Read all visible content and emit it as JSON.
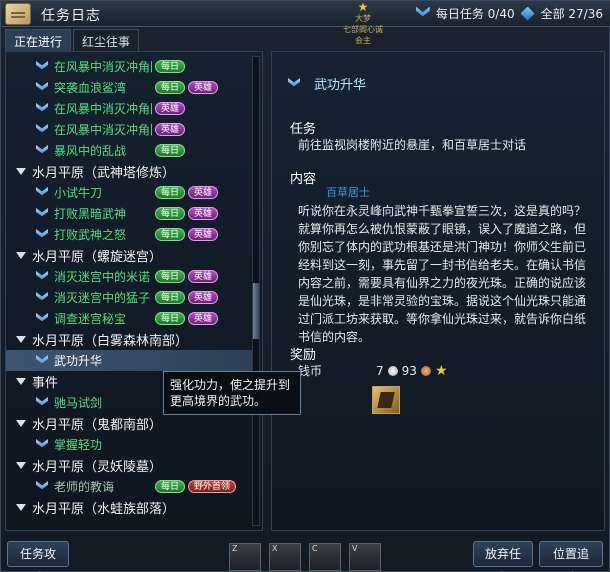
{
  "window": {
    "title": "任务日志",
    "npc_badge": "大梦",
    "npc_badge_sub": "七部阁心诚会主",
    "daily_tasks": "每日任务 0/40",
    "all_tasks": "全部 27/36"
  },
  "tabs": [
    {
      "label": "正在进行",
      "active": true
    },
    {
      "label": "红尘往事",
      "active": false
    }
  ],
  "quest_list": [
    {
      "type": "quest",
      "name": "在风暴中消灭冲角团合作者",
      "tags": [
        "daily"
      ],
      "color": "green"
    },
    {
      "type": "quest",
      "name": "突袭血浪鲨湾",
      "tags": [
        "daily",
        "elite"
      ],
      "color": "green"
    },
    {
      "type": "quest",
      "name": "在风暴中消灭冲角团内务...",
      "tags": [
        "elite"
      ],
      "color": "green"
    },
    {
      "type": "quest",
      "name": "在风暴中消灭冲角团队长",
      "tags": [
        "elite"
      ],
      "color": "green"
    },
    {
      "type": "quest",
      "name": "暴风中的乱战",
      "tags": [
        "daily"
      ],
      "color": "green"
    },
    {
      "type": "group",
      "name": "水月平原（武神塔修炼）"
    },
    {
      "type": "quest",
      "name": "小试牛刀",
      "tags": [
        "daily",
        "elite"
      ],
      "color": "green"
    },
    {
      "type": "quest",
      "name": "打败黑暗武神",
      "tags": [
        "daily",
        "elite"
      ],
      "color": "green"
    },
    {
      "type": "quest",
      "name": "打败武神之怒",
      "tags": [
        "daily",
        "elite"
      ],
      "color": "green"
    },
    {
      "type": "group",
      "name": "水月平原（螺旋迷宫）"
    },
    {
      "type": "quest",
      "name": "消灭迷宫中的米诺",
      "tags": [
        "daily",
        "elite"
      ],
      "color": "green"
    },
    {
      "type": "quest",
      "name": "消灭迷宫中的猛子",
      "tags": [
        "daily",
        "elite"
      ],
      "color": "green"
    },
    {
      "type": "quest",
      "name": "调查迷宫秘宝",
      "tags": [
        "daily",
        "elite"
      ],
      "color": "green"
    },
    {
      "type": "group",
      "name": "水月平原（白雾森林南部）"
    },
    {
      "type": "quest",
      "name": "武功升华",
      "tags": [],
      "color": "selected"
    },
    {
      "type": "group",
      "name": "事件"
    },
    {
      "type": "quest",
      "name": "驰马试剑",
      "tags": [],
      "color": "green"
    },
    {
      "type": "group",
      "name": "水月平原（鬼都南部）"
    },
    {
      "type": "quest",
      "name": "掌握轻功",
      "tags": [],
      "color": "green"
    },
    {
      "type": "group",
      "name": "水月平原（灵妖陵墓）"
    },
    {
      "type": "quest",
      "name": "老师的教诲",
      "tags": [
        "daily",
        "special"
      ],
      "color": "gray"
    },
    {
      "type": "group",
      "name": "水月平原（水蛙族部落）"
    }
  ],
  "tag_labels": {
    "daily": "每日",
    "elite": "英雄",
    "special": "野外首领"
  },
  "tooltip": "强化功力，使之提升到更高境界的武功。",
  "detail": {
    "title": "武功升华",
    "task_heading": "任务",
    "task_text": "前往监视岗楼附近的悬崖，和百草居士对话",
    "content_heading": "内容",
    "npc": "百草居士",
    "content_text": "听说你在永灵峰向武神千甄拳宣誓三次，这是真的吗？就算你再怎么被仇恨蒙蔽了眼镜，误入了魔道之路，但你别忘了体内的武功根基还是洪门神功！你师父生前已经料到这一刻，事先留了一封书信给老夫。在确认书信内容之前，需要具有仙界之力的夜光珠。正确的说应该是仙光珠，是非常灵验的宝珠。据说这个仙光珠只能通过门派工坊来获取。等你拿仙光珠过来，就告诉你白纸书信的内容。",
    "reward_heading": "奖励",
    "money_label": "钱币",
    "money_silver": "7",
    "money_copper": "93"
  },
  "bottom": {
    "guide_button": "任务攻略",
    "abandon_button": "放弃任务",
    "track_button": "位置追踪",
    "hotkeys": [
      "Z",
      "X",
      "C",
      "V"
    ]
  }
}
